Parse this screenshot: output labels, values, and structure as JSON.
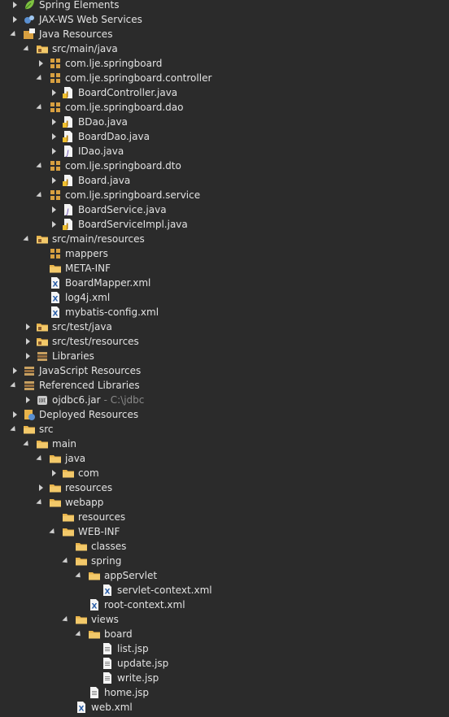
{
  "tree": [
    {
      "label": "Spring Elements",
      "icon": "spring-leaf-icon",
      "level": 0,
      "toggle": "collapsed"
    },
    {
      "label": "JAX-WS Web Services",
      "icon": "web-services-icon",
      "level": 0,
      "toggle": "collapsed"
    },
    {
      "label": "Java Resources",
      "icon": "java-resources-icon",
      "level": 0,
      "toggle": "expanded"
    },
    {
      "label": "src/main/java",
      "icon": "source-folder-icon",
      "level": 1,
      "toggle": "expanded"
    },
    {
      "label": "com.lje.springboard",
      "icon": "package-icon",
      "level": 2,
      "toggle": "collapsed"
    },
    {
      "label": "com.lje.springboard.controller",
      "icon": "package-icon",
      "level": 2,
      "toggle": "expanded"
    },
    {
      "label": "BoardController.java",
      "icon": "java-class-file-icon",
      "level": 3,
      "toggle": "collapsed"
    },
    {
      "label": "com.lje.springboard.dao",
      "icon": "package-icon",
      "level": 2,
      "toggle": "expanded"
    },
    {
      "label": "BDao.java",
      "icon": "java-class-file-icon",
      "level": 3,
      "toggle": "collapsed"
    },
    {
      "label": "BoardDao.java",
      "icon": "java-class-file-icon",
      "level": 3,
      "toggle": "collapsed"
    },
    {
      "label": "IDao.java",
      "icon": "java-interface-file-icon",
      "level": 3,
      "toggle": "collapsed"
    },
    {
      "label": "com.lje.springboard.dto",
      "icon": "package-icon",
      "level": 2,
      "toggle": "expanded"
    },
    {
      "label": "Board.java",
      "icon": "java-class-file-icon",
      "level": 3,
      "toggle": "collapsed"
    },
    {
      "label": "com.lje.springboard.service",
      "icon": "package-icon",
      "level": 2,
      "toggle": "expanded"
    },
    {
      "label": "BoardService.java",
      "icon": "java-interface-file-icon",
      "level": 3,
      "toggle": "collapsed"
    },
    {
      "label": "BoardServiceImpl.java",
      "icon": "java-class-file-icon",
      "level": 3,
      "toggle": "collapsed"
    },
    {
      "label": "src/main/resources",
      "icon": "source-folder-icon",
      "level": 1,
      "toggle": "expanded"
    },
    {
      "label": "mappers",
      "icon": "package-icon",
      "level": 2,
      "toggle": "none"
    },
    {
      "label": "META-INF",
      "icon": "folder-icon",
      "level": 2,
      "toggle": "none"
    },
    {
      "label": "BoardMapper.xml",
      "icon": "xml-file-icon",
      "level": 2,
      "toggle": "none"
    },
    {
      "label": "log4j.xml",
      "icon": "xml-file-icon",
      "level": 2,
      "toggle": "none"
    },
    {
      "label": "mybatis-config.xml",
      "icon": "xml-file-icon",
      "level": 2,
      "toggle": "none"
    },
    {
      "label": "src/test/java",
      "icon": "source-folder-icon",
      "level": 1,
      "toggle": "collapsed"
    },
    {
      "label": "src/test/resources",
      "icon": "source-folder-icon",
      "level": 1,
      "toggle": "collapsed"
    },
    {
      "label": "Libraries",
      "icon": "libraries-icon",
      "level": 1,
      "toggle": "collapsed"
    },
    {
      "label": "JavaScript Resources",
      "icon": "javascript-resources-icon",
      "level": 0,
      "toggle": "collapsed"
    },
    {
      "label": "Referenced Libraries",
      "icon": "libraries-icon",
      "level": 0,
      "toggle": "expanded"
    },
    {
      "label": "ojdbc6.jar",
      "icon": "jar-file-icon",
      "level": 1,
      "toggle": "collapsed",
      "decoration": "- C:\\jdbc"
    },
    {
      "label": "Deployed Resources",
      "icon": "deployed-resources-icon",
      "level": 0,
      "toggle": "collapsed"
    },
    {
      "label": "src",
      "icon": "folder-icon",
      "level": 0,
      "toggle": "expanded"
    },
    {
      "label": "main",
      "icon": "folder-icon",
      "level": 1,
      "toggle": "expanded"
    },
    {
      "label": "java",
      "icon": "folder-icon",
      "level": 2,
      "toggle": "expanded"
    },
    {
      "label": "com",
      "icon": "folder-icon",
      "level": 3,
      "toggle": "collapsed"
    },
    {
      "label": "resources",
      "icon": "folder-icon",
      "level": 2,
      "toggle": "collapsed"
    },
    {
      "label": "webapp",
      "icon": "folder-icon",
      "level": 2,
      "toggle": "expanded"
    },
    {
      "label": "resources",
      "icon": "folder-icon",
      "level": 3,
      "toggle": "none"
    },
    {
      "label": "WEB-INF",
      "icon": "folder-icon",
      "level": 3,
      "toggle": "expanded"
    },
    {
      "label": "classes",
      "icon": "folder-icon",
      "level": 4,
      "toggle": "none"
    },
    {
      "label": "spring",
      "icon": "folder-icon",
      "level": 4,
      "toggle": "expanded"
    },
    {
      "label": "appServlet",
      "icon": "folder-icon",
      "level": 5,
      "toggle": "expanded"
    },
    {
      "label": "servlet-context.xml",
      "icon": "xml-file-icon",
      "level": 6,
      "toggle": "none"
    },
    {
      "label": "root-context.xml",
      "icon": "xml-file-icon",
      "level": 5,
      "toggle": "none"
    },
    {
      "label": "views",
      "icon": "folder-icon",
      "level": 4,
      "toggle": "expanded"
    },
    {
      "label": "board",
      "icon": "folder-icon",
      "level": 5,
      "toggle": "expanded"
    },
    {
      "label": "list.jsp",
      "icon": "jsp-file-icon",
      "level": 6,
      "toggle": "none"
    },
    {
      "label": "update.jsp",
      "icon": "jsp-file-icon",
      "level": 6,
      "toggle": "none"
    },
    {
      "label": "write.jsp",
      "icon": "jsp-file-icon",
      "level": 6,
      "toggle": "none"
    },
    {
      "label": "home.jsp",
      "icon": "jsp-file-icon",
      "level": 5,
      "toggle": "none"
    },
    {
      "label": "web.xml",
      "icon": "xml-file-icon",
      "level": 4,
      "toggle": "none"
    }
  ]
}
